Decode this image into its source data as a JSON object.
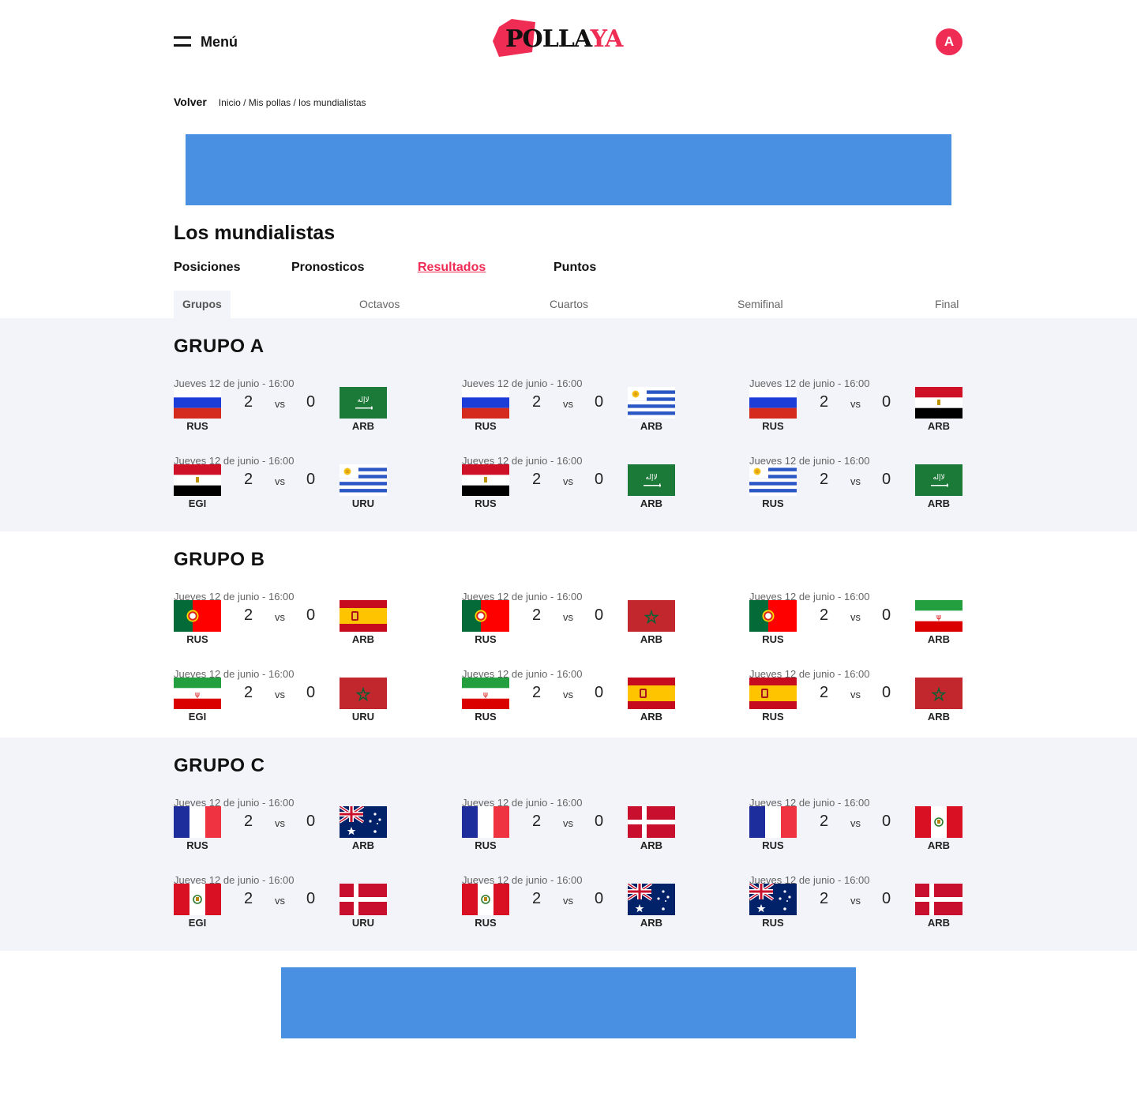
{
  "header": {
    "menu_label": "Menú",
    "logo_part1": "POLLA",
    "logo_part2": "YA",
    "avatar_initial": "A",
    "brand_color": "#ef2d54"
  },
  "breadcrumb": {
    "back_label": "Volver",
    "items": [
      "Inicio",
      "Mis pollas",
      "los mundialistas"
    ],
    "separator": " / "
  },
  "page_title": "Los mundialistas",
  "tabs": [
    {
      "label": "Posiciones",
      "active": false
    },
    {
      "label": "Pronosticos",
      "active": false
    },
    {
      "label": "Resultados",
      "active": true
    },
    {
      "label": "Puntos",
      "active": false
    }
  ],
  "subtabs": [
    {
      "label": "Grupos",
      "active": true
    },
    {
      "label": "Octavos",
      "active": false
    },
    {
      "label": "Cuartos",
      "active": false
    },
    {
      "label": "Semifinal",
      "active": false
    },
    {
      "label": "Final",
      "active": false
    }
  ],
  "vs_label": "vs",
  "groups": [
    {
      "title": "GRUPO A",
      "shaded": true,
      "matches": [
        {
          "date": "Jueves 12 de junio - 16:00",
          "home_flag": "russia-flag",
          "home_code": "RUS",
          "home_score": "2",
          "away_score": "0",
          "away_flag": "saudi-arabia-flag",
          "away_code": "ARB"
        },
        {
          "date": "Jueves 12 de junio - 16:00",
          "home_flag": "russia-flag",
          "home_code": "RUS",
          "home_score": "2",
          "away_score": "0",
          "away_flag": "uruguay-flag",
          "away_code": "ARB"
        },
        {
          "date": "Jueves 12 de junio - 16:00",
          "home_flag": "russia-flag",
          "home_code": "RUS",
          "home_score": "2",
          "away_score": "0",
          "away_flag": "egypt-flag",
          "away_code": "ARB"
        },
        {
          "date": "Jueves 12 de junio - 16:00",
          "home_flag": "egypt-flag",
          "home_code": "EGI",
          "home_score": "2",
          "away_score": "0",
          "away_flag": "uruguay-flag",
          "away_code": "URU"
        },
        {
          "date": "Jueves 12 de junio - 16:00",
          "home_flag": "egypt-flag",
          "home_code": "RUS",
          "home_score": "2",
          "away_score": "0",
          "away_flag": "saudi-arabia-flag",
          "away_code": "ARB"
        },
        {
          "date": "Jueves 12 de junio - 16:00",
          "home_flag": "uruguay-flag",
          "home_code": "RUS",
          "home_score": "2",
          "away_score": "0",
          "away_flag": "saudi-arabia-flag",
          "away_code": "ARB"
        }
      ]
    },
    {
      "title": "GRUPO B",
      "shaded": false,
      "matches": [
        {
          "date": "Jueves 12 de junio - 16:00",
          "home_flag": "portugal-flag",
          "home_code": "RUS",
          "home_score": "2",
          "away_score": "0",
          "away_flag": "spain-flag",
          "away_code": "ARB"
        },
        {
          "date": "Jueves 12 de junio - 16:00",
          "home_flag": "portugal-flag",
          "home_code": "RUS",
          "home_score": "2",
          "away_score": "0",
          "away_flag": "morocco-flag",
          "away_code": "ARB"
        },
        {
          "date": "Jueves 12 de junio - 16:00",
          "home_flag": "portugal-flag",
          "home_code": "RUS",
          "home_score": "2",
          "away_score": "0",
          "away_flag": "iran-flag",
          "away_code": "ARB"
        },
        {
          "date": "Jueves 12 de junio - 16:00",
          "home_flag": "iran-flag",
          "home_code": "EGI",
          "home_score": "2",
          "away_score": "0",
          "away_flag": "morocco-flag",
          "away_code": "URU"
        },
        {
          "date": "Jueves 12 de junio - 16:00",
          "home_flag": "iran-flag",
          "home_code": "RUS",
          "home_score": "2",
          "away_score": "0",
          "away_flag": "spain-flag",
          "away_code": "ARB"
        },
        {
          "date": "Jueves 12 de junio - 16:00",
          "home_flag": "spain-flag",
          "home_code": "RUS",
          "home_score": "2",
          "away_score": "0",
          "away_flag": "morocco-flag",
          "away_code": "ARB"
        }
      ]
    },
    {
      "title": "GRUPO C",
      "shaded": true,
      "matches": [
        {
          "date": "Jueves 12 de junio - 16:00",
          "home_flag": "france-flag",
          "home_code": "RUS",
          "home_score": "2",
          "away_score": "0",
          "away_flag": "australia-flag",
          "away_code": "ARB"
        },
        {
          "date": "Jueves 12 de junio - 16:00",
          "home_flag": "france-flag",
          "home_code": "RUS",
          "home_score": "2",
          "away_score": "0",
          "away_flag": "denmark-flag",
          "away_code": "ARB"
        },
        {
          "date": "Jueves 12 de junio - 16:00",
          "home_flag": "france-flag",
          "home_code": "RUS",
          "home_score": "2",
          "away_score": "0",
          "away_flag": "peru-flag",
          "away_code": "ARB"
        },
        {
          "date": "Jueves 12 de junio - 16:00",
          "home_flag": "peru-flag",
          "home_code": "EGI",
          "home_score": "2",
          "away_score": "0",
          "away_flag": "denmark-flag",
          "away_code": "URU"
        },
        {
          "date": "Jueves 12 de junio - 16:00",
          "home_flag": "peru-flag",
          "home_code": "RUS",
          "home_score": "2",
          "away_score": "0",
          "away_flag": "australia-flag",
          "away_code": "ARB"
        },
        {
          "date": "Jueves 12 de junio - 16:00",
          "home_flag": "australia-flag",
          "home_code": "RUS",
          "home_score": "2",
          "away_score": "0",
          "away_flag": "denmark-flag",
          "away_code": "ARB"
        }
      ]
    }
  ],
  "colors": {
    "accent": "#ef2d54",
    "ad_placeholder": "#4a90e2",
    "section_background": "#f3f4f9"
  }
}
